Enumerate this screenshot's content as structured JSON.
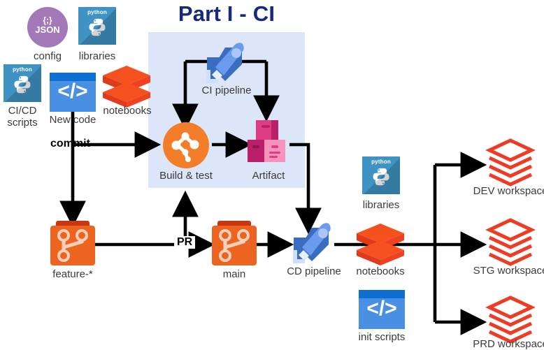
{
  "diagram": {
    "title": "Part I - CI",
    "title_color": "#17297a",
    "ci_box_color": "#dce6f8"
  },
  "nodes": {
    "config": {
      "label": "config",
      "icon": "json-circle-icon",
      "color": "#a378b8"
    },
    "libraries_top": {
      "label": "libraries",
      "icon": "python-icon",
      "color": "#3e93c4"
    },
    "cicd_scripts": {
      "label": "CI/CD\nscripts",
      "icon": "python-icon",
      "color": "#3e93c4"
    },
    "new_code": {
      "label": "New code",
      "icon": "code-window-icon",
      "color": "#4a90e2"
    },
    "notebooks_top": {
      "label": "notebooks",
      "icon": "databricks-stack-icon",
      "color": "#ef4123"
    },
    "ci_pipeline": {
      "label": "CI pipeline",
      "icon": "rocket-pipeline-icon",
      "color": "#5b8ddb"
    },
    "build_test": {
      "label": "Build & test",
      "icon": "build-merge-icon",
      "color": "#f37d28"
    },
    "artifact": {
      "label": "Artifact",
      "icon": "artifact-boxes-icon",
      "color": "#d6337b"
    },
    "feature_branch": {
      "label": "feature-*",
      "icon": "git-repo-icon",
      "color": "#ec6420"
    },
    "main_branch": {
      "label": "main",
      "icon": "git-repo-icon",
      "color": "#ec6420"
    },
    "cd_pipeline": {
      "label": "CD pipeline",
      "icon": "rocket-pipeline-icon",
      "color": "#5b8ddb"
    },
    "notebooks_mid": {
      "label": "notebooks",
      "icon": "databricks-stack-icon",
      "color": "#ef4123"
    },
    "libraries_mid": {
      "label": "libraries",
      "icon": "python-icon",
      "color": "#3e93c4"
    },
    "init_scripts": {
      "label": "init scripts",
      "icon": "code-window-icon",
      "color": "#4a90e2"
    },
    "dev_workspace": {
      "label": "DEV workspace",
      "icon": "databricks-outline-icon",
      "color": "#ee3b24"
    },
    "stg_workspace": {
      "label": "STG workspace",
      "icon": "databricks-outline-icon",
      "color": "#ee3b24"
    },
    "prd_workspace": {
      "label": "PRD workspace",
      "icon": "databricks-outline-icon",
      "color": "#ee3b24"
    }
  },
  "edges": {
    "commit": "commit",
    "pull_request": "PR"
  },
  "icon_text": {
    "python_word": "python",
    "json_braces": "{;}",
    "json_word": "JSON",
    "code_glyph": "</>"
  }
}
